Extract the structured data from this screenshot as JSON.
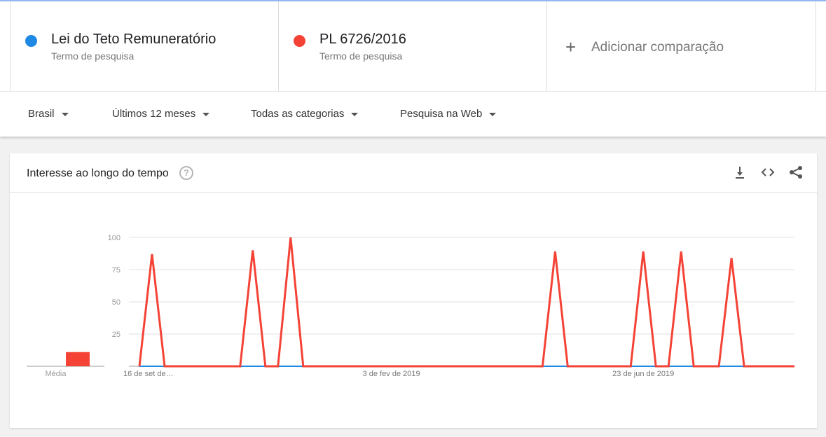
{
  "terms": [
    {
      "name": "Lei do Teto Remuneratório",
      "subtitle": "Termo de pesquisa",
      "color": "#1e88e5"
    },
    {
      "name": "PL 6726/2016",
      "subtitle": "Termo de pesquisa",
      "color": "#f44336"
    }
  ],
  "add_comparison": {
    "label": "Adicionar comparação",
    "icon": "plus-icon"
  },
  "filters": {
    "region": "Brasil",
    "period": "Últimos 12 meses",
    "category": "Todas as categorias",
    "search_type": "Pesquisa na Web"
  },
  "card": {
    "title": "Interesse ao longo do tempo",
    "help_icon": "help-icon",
    "tools": [
      "download-icon",
      "embed-code-icon",
      "share-icon"
    ]
  },
  "chart_data": {
    "type": "line",
    "yticks": [
      25,
      50,
      75,
      100
    ],
    "ylim": [
      0,
      100
    ],
    "x_tick_labels": [
      "16 de set de…",
      "3 de fev de 2019",
      "23 de jun de 2019"
    ],
    "x_tick_index": [
      0,
      20,
      40
    ],
    "average_label": "Média",
    "averages": [
      0,
      11
    ],
    "series": [
      {
        "name": "Lei do Teto Remuneratório",
        "color": "#1e88e5",
        "values": [
          0,
          0,
          0,
          0,
          0,
          0,
          0,
          0,
          0,
          0,
          0,
          0,
          0,
          0,
          0,
          0,
          0,
          0,
          0,
          0,
          0,
          0,
          0,
          0,
          0,
          0,
          0,
          0,
          0,
          0,
          0,
          0,
          0,
          0,
          0,
          0,
          0,
          0,
          0,
          0,
          0,
          0,
          0,
          0,
          0,
          0,
          0,
          0,
          0,
          0,
          0,
          0,
          0
        ]
      },
      {
        "name": "PL 6726/2016",
        "color": "#f44336",
        "values": [
          0,
          87,
          0,
          0,
          0,
          0,
          0,
          0,
          0,
          90,
          0,
          0,
          100,
          0,
          0,
          0,
          0,
          0,
          0,
          0,
          0,
          0,
          0,
          0,
          0,
          0,
          0,
          0,
          0,
          0,
          0,
          0,
          0,
          89,
          0,
          0,
          0,
          0,
          0,
          0,
          89,
          0,
          0,
          89,
          0,
          0,
          0,
          84,
          0,
          0,
          0,
          0,
          0
        ]
      }
    ]
  }
}
